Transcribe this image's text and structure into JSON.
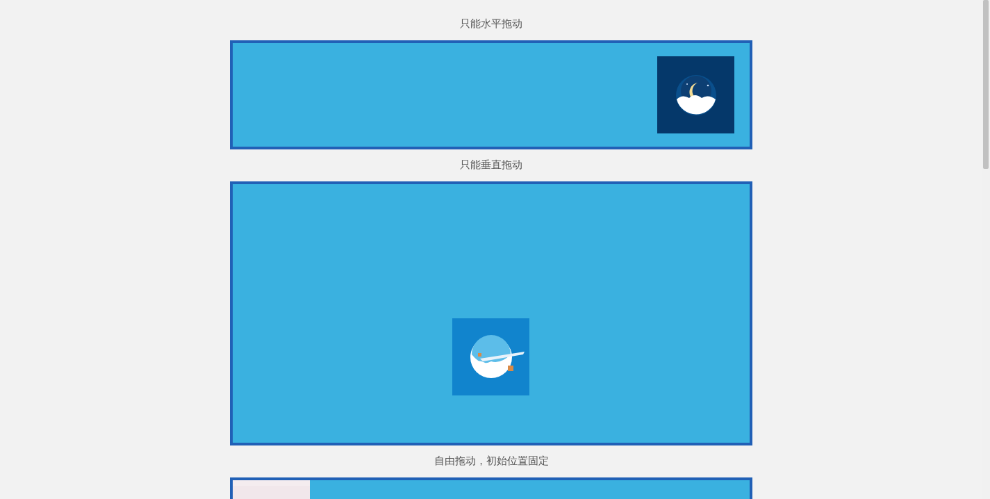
{
  "sections": [
    {
      "title": "只能水平拖动"
    },
    {
      "title": "只能垂直拖动"
    },
    {
      "title": "自由拖动，初始位置固定"
    }
  ]
}
